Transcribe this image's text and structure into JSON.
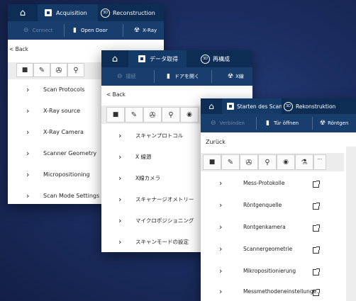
{
  "panels": {
    "en": {
      "tabs": {
        "home": "⌂",
        "acquisition": "Acquisition",
        "reconstruction": "Reconstruction"
      },
      "sub": {
        "connect": "Connect",
        "open_door": "Open Door",
        "xray": "X-Ray"
      },
      "back": "< Back",
      "items": [
        "Scan Protocols",
        "X-Ray source",
        "X-Ray Camera",
        "Scanner Geometry",
        "Micropositioning",
        "Scan Mode Settings"
      ]
    },
    "ja": {
      "tabs": {
        "home": "⌂",
        "acquisition": "データ取得",
        "reconstruction": "再構成"
      },
      "sub": {
        "connect": "接続",
        "open_door": "ドアを開く",
        "xray": "X線"
      },
      "back": "< Back",
      "items": [
        "スキャンプロトコル",
        "X 線源",
        "X線カメラ",
        "スキャナージオメトリー",
        "マイクロポジショニング",
        "スキャンモードの設定"
      ]
    },
    "de": {
      "tabs": {
        "home": "⌂",
        "acquisition": "Starten des Scans",
        "reconstruction": "Rekonstruktion"
      },
      "sub": {
        "connect": "Verbinden",
        "open_door": "Tür öffnen",
        "xray": "Röntgen"
      },
      "back": "Zurück",
      "items": [
        "Mess-Protokolle",
        "Röntgenquelle",
        "Rontgenkamera",
        "Scannergeometrie",
        "Mikropositionierung",
        "Messmethodeneinstellungen"
      ]
    }
  },
  "glyphs": {
    "chevron": "›",
    "folder": "■",
    "pencil": "✎",
    "aperture": "✇",
    "search": "⚲",
    "eye": "◉",
    "flask": "⚗",
    "more": "···",
    "link": "⊖",
    "door": "▮",
    "radiation": "☢"
  },
  "colors": {
    "topbar": "#0e2d55",
    "subbar": "#183e6e",
    "background": "#1c2f63"
  }
}
